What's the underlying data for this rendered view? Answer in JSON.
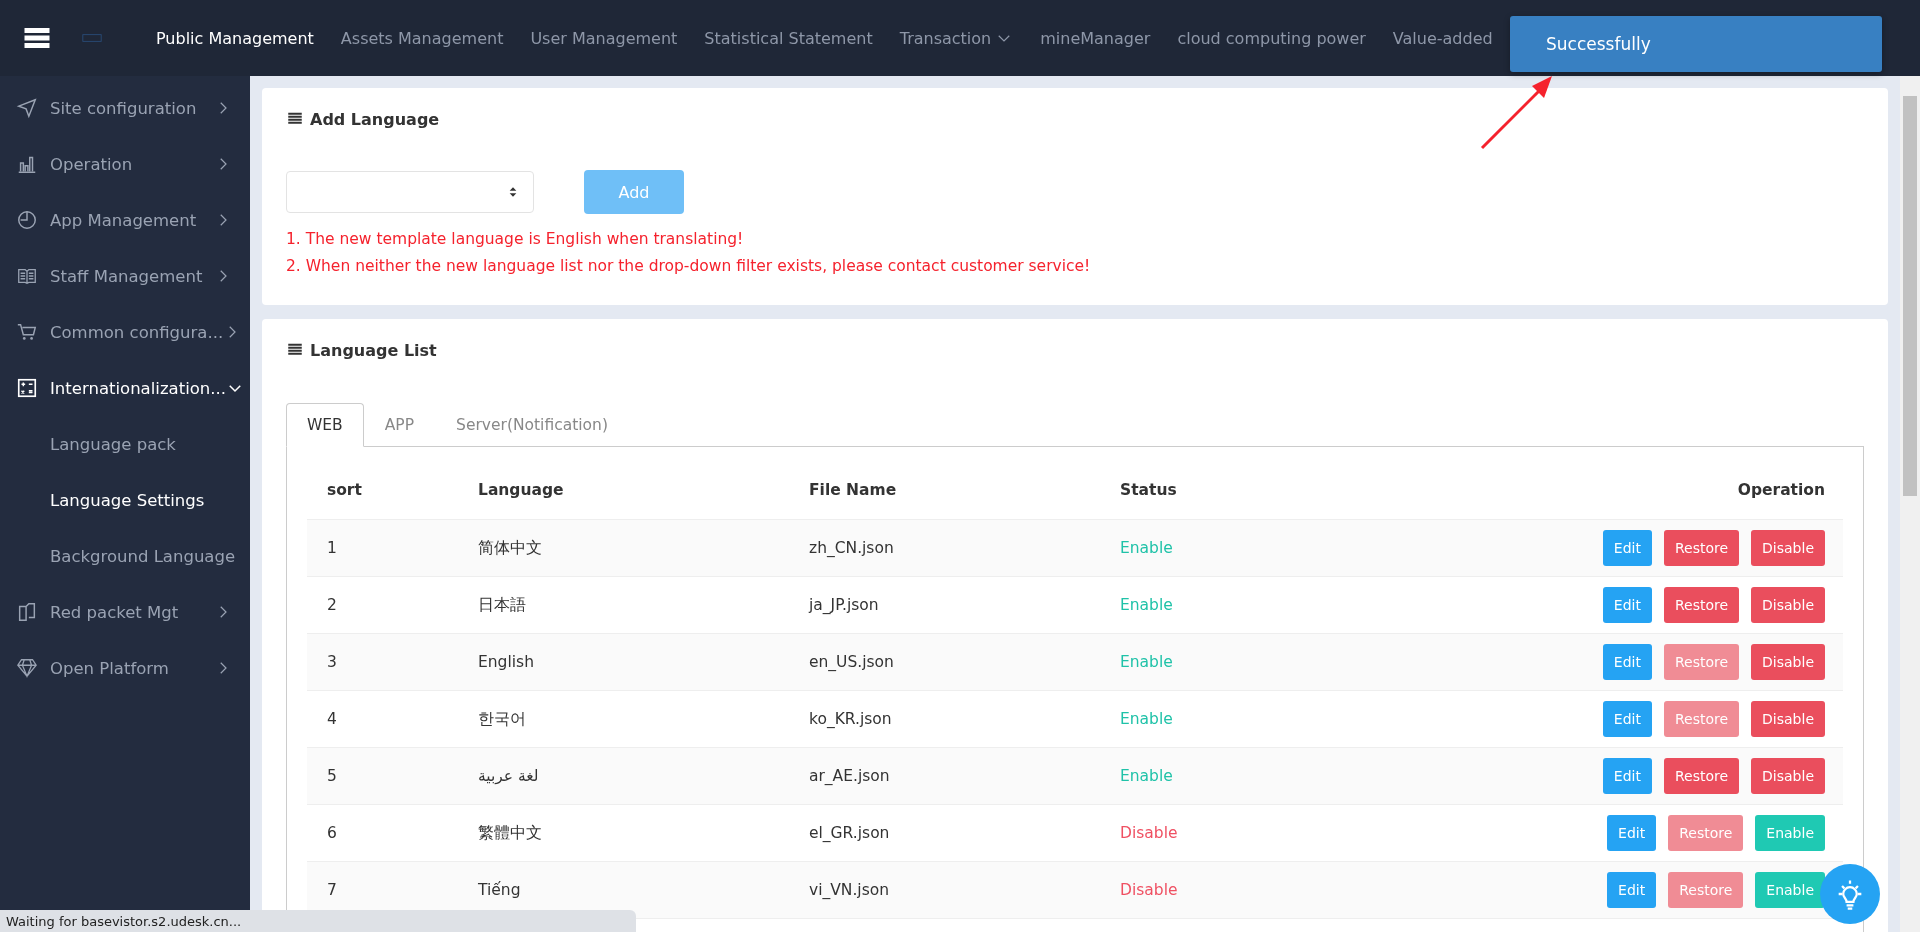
{
  "top_nav": {
    "items": [
      {
        "label": "Public Management",
        "selected": true,
        "dropdown": false
      },
      {
        "label": "Assets Management",
        "selected": false,
        "dropdown": false
      },
      {
        "label": "User Management",
        "selected": false,
        "dropdown": false
      },
      {
        "label": "Statistical Statement",
        "selected": false,
        "dropdown": false
      },
      {
        "label": "Transaction",
        "selected": false,
        "dropdown": true
      },
      {
        "label": "mineManager",
        "selected": false,
        "dropdown": false
      },
      {
        "label": "cloud computing power",
        "selected": false,
        "dropdown": false
      },
      {
        "label": "Value-added",
        "selected": false,
        "dropdown": false
      }
    ]
  },
  "toast": {
    "message": "Successfully"
  },
  "sidebar": {
    "items": [
      {
        "label": "Site configuration",
        "expanded": false
      },
      {
        "label": "Operation",
        "expanded": false
      },
      {
        "label": "App Management",
        "expanded": false
      },
      {
        "label": "Staff Management",
        "expanded": false
      },
      {
        "label": "Common configura...",
        "expanded": false
      },
      {
        "label": "Internationalization...",
        "expanded": true,
        "children": [
          {
            "label": "Language pack",
            "selected": false
          },
          {
            "label": "Language Settings",
            "selected": true
          },
          {
            "label": "Background Language",
            "selected": false
          }
        ]
      },
      {
        "label": "Red packet Mgt",
        "expanded": false
      },
      {
        "label": "Open Platform",
        "expanded": false
      }
    ]
  },
  "add_language": {
    "title": "Add Language",
    "button": "Add",
    "notes": [
      "1. The new template language is English when translating!",
      "2. When neither the new language list nor the drop-down filter exists, please contact customer service!"
    ]
  },
  "language_list": {
    "title": "Language List",
    "tabs": [
      {
        "label": "WEB",
        "selected": true
      },
      {
        "label": "APP",
        "selected": false
      },
      {
        "label": "Server(Notification)",
        "selected": false
      }
    ],
    "table": {
      "columns": [
        "sort",
        "Language",
        "File Name",
        "Status",
        "Operation"
      ],
      "rows": [
        {
          "sort": "1",
          "language": "简体中文",
          "file": "zh_CN.json",
          "status": "Enable",
          "enabled": true,
          "restore_disabled": false,
          "buttons": [
            "Edit",
            "Restore",
            "Disable"
          ]
        },
        {
          "sort": "2",
          "language": "日本語",
          "file": "ja_JP.json",
          "status": "Enable",
          "enabled": true,
          "restore_disabled": false,
          "buttons": [
            "Edit",
            "Restore",
            "Disable"
          ]
        },
        {
          "sort": "3",
          "language": "English",
          "file": "en_US.json",
          "status": "Enable",
          "enabled": true,
          "restore_disabled": true,
          "buttons": [
            "Edit",
            "Restore",
            "Disable"
          ]
        },
        {
          "sort": "4",
          "language": "한국어",
          "file": "ko_KR.json",
          "status": "Enable",
          "enabled": true,
          "restore_disabled": true,
          "buttons": [
            "Edit",
            "Restore",
            "Disable"
          ]
        },
        {
          "sort": "5",
          "language": "لغة عربية",
          "file": "ar_AE.json",
          "status": "Enable",
          "enabled": true,
          "restore_disabled": false,
          "buttons": [
            "Edit",
            "Restore",
            "Disable"
          ]
        },
        {
          "sort": "6",
          "language": "繁體中文",
          "file": "el_GR.json",
          "status": "Disable",
          "enabled": false,
          "restore_disabled": true,
          "buttons": [
            "Edit",
            "Restore",
            "Enable"
          ]
        },
        {
          "sort": "7",
          "language": "Tiếng",
          "file": "vi_VN.json",
          "status": "Disable",
          "enabled": false,
          "restore_disabled": true,
          "buttons": [
            "Edit",
            "Restore",
            "Enable"
          ]
        }
      ]
    }
  },
  "browser_status": "Waiting for basevistor.s2.udesk.cn..."
}
